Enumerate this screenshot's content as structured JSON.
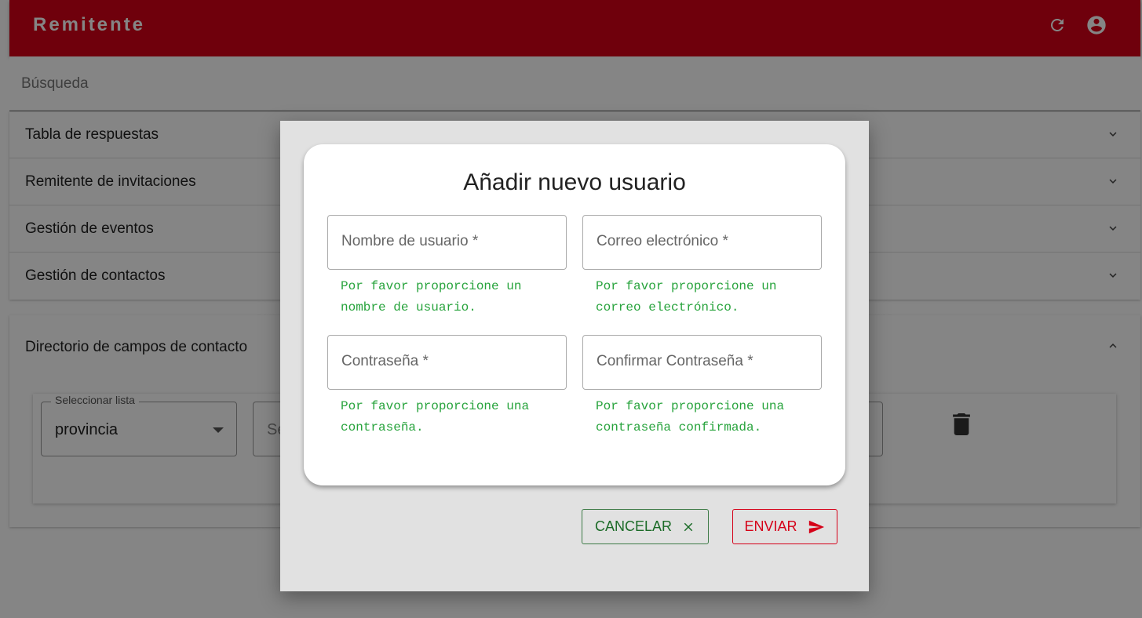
{
  "header": {
    "title": "Remitente",
    "refresh_icon": "refresh-icon",
    "account_icon": "account-circle-icon",
    "brand_color": "#d50018"
  },
  "search": {
    "label": "Búsqueda"
  },
  "accordion": {
    "items": [
      {
        "label": "Tabla de respuestas"
      },
      {
        "label": "Remitente de invitaciones"
      },
      {
        "label": "Gestión de eventos"
      },
      {
        "label": "Gestión de contactos"
      }
    ]
  },
  "directory": {
    "title": "Directorio de campos de contacto",
    "select_label": "Seleccionar lista",
    "select_value": "provincia",
    "second_field_partial": "Se"
  },
  "dialog": {
    "title": "Añadir nuevo usuario",
    "fields": {
      "username": {
        "label": "Nombre de usuario *",
        "helper": "Por favor proporcione un nombre de usuario."
      },
      "email": {
        "label": "Correo electrónico *",
        "helper": "Por favor proporcione un correo electrónico."
      },
      "password": {
        "label": "Contraseña *",
        "helper": "Por favor proporcione una contraseña."
      },
      "confirm": {
        "label": "Confirmar Contraseña *",
        "helper": "Por favor proporcione una contraseña confirmada."
      }
    },
    "actions": {
      "cancel": "CANCELAR",
      "send": "ENVIAR"
    },
    "helper_color": "#27a33c"
  }
}
